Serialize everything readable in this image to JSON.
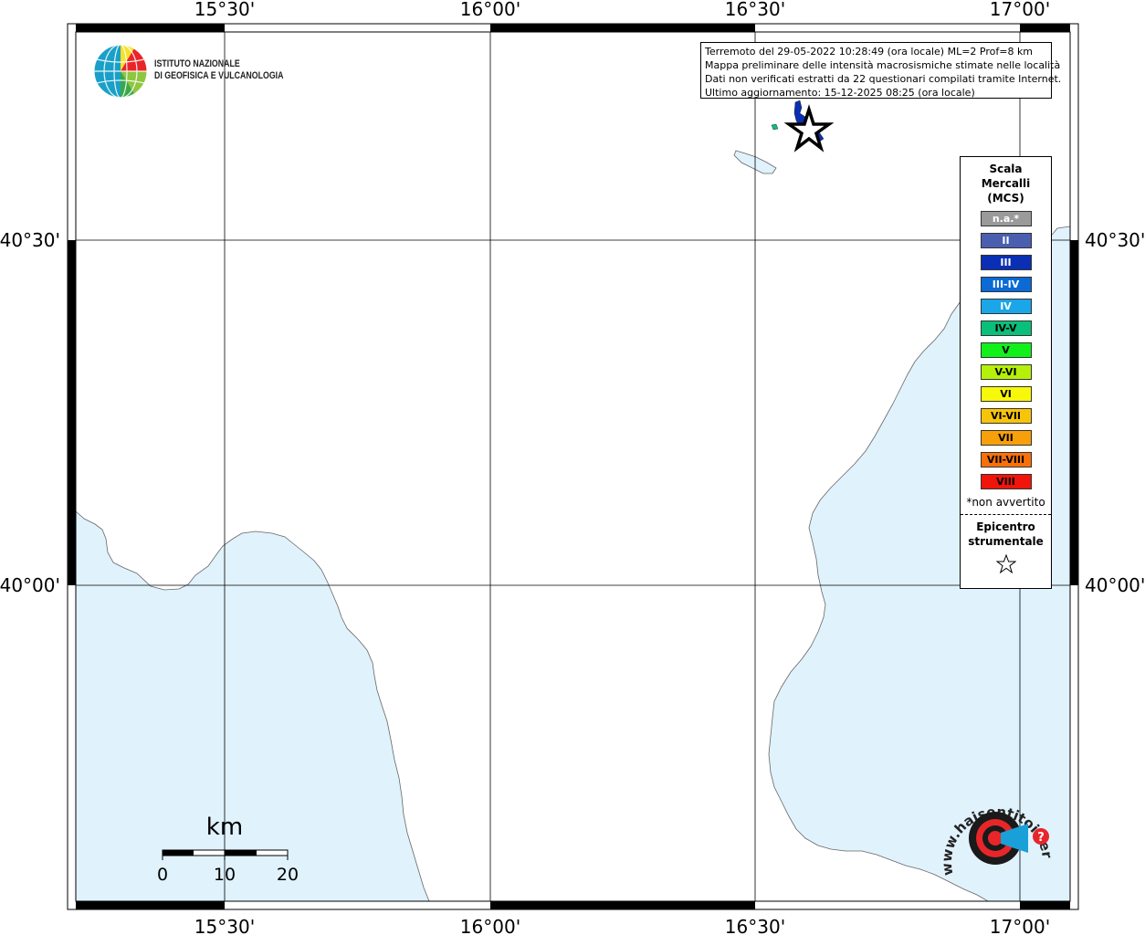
{
  "map": {
    "x_ticks": [
      "15°30'",
      "16°00'",
      "16°30'",
      "17°00'"
    ],
    "y_ticks": [
      "40°30'",
      "40°00'"
    ],
    "land_color": "#ffffff",
    "sea_color": "#e0f2fc",
    "grid_color": "#000000"
  },
  "info": {
    "line1": "Terremoto del 29-05-2022 10:28:49 (ora locale) ML=2 Prof=8 km",
    "line2": "Mappa preliminare delle intensità macrosismiche stimate nelle località",
    "line3": "Dati non verificati estratti da 22 questionari compilati tramite Internet.",
    "line4": "Ultimo aggiornamento: 15-12-2025 08:25 (ora locale)"
  },
  "legend": {
    "title_line1": "Scala",
    "title_line2": "Mercalli",
    "title_line3": "(MCS)",
    "items": [
      {
        "label": "n.a.*",
        "color": "#9a9a9a",
        "text_color": "#ffffff"
      },
      {
        "label": "II",
        "color": "#4a5fb0",
        "text_color": "#ffffff"
      },
      {
        "label": "III",
        "color": "#0a2fb4",
        "text_color": "#ffffff"
      },
      {
        "label": "III-IV",
        "color": "#0a6ad6",
        "text_color": "#ffffff"
      },
      {
        "label": "IV",
        "color": "#1aa6e8",
        "text_color": "#ffffff"
      },
      {
        "label": "IV-V",
        "color": "#0abf7a",
        "text_color": "#000000"
      },
      {
        "label": "V",
        "color": "#12f01a",
        "text_color": "#000000"
      },
      {
        "label": "V-VI",
        "color": "#b4f00a",
        "text_color": "#000000"
      },
      {
        "label": "VI",
        "color": "#f8f80a",
        "text_color": "#000000"
      },
      {
        "label": "VI-VII",
        "color": "#f8c40a",
        "text_color": "#000000"
      },
      {
        "label": "VII",
        "color": "#f8a00a",
        "text_color": "#000000"
      },
      {
        "label": "VII-VIII",
        "color": "#f8700a",
        "text_color": "#000000"
      },
      {
        "label": "VIII",
        "color": "#f0140a",
        "text_color": "#000000"
      }
    ],
    "note": "*non avvertito",
    "epicenter_line1": "Epicentro",
    "epicenter_line2": "strumentale"
  },
  "scale_bar": {
    "unit": "km",
    "ticks": [
      "0",
      "10",
      "20"
    ]
  },
  "ingv": {
    "line1": "ISTITUTO NAZIONALE",
    "line2": "DI GEOFISICA E VULCANOLOGIA"
  },
  "hsit": {
    "text": "www.haisentitoilterremoto.it"
  },
  "icons": [
    "ingv-globe-icon",
    "epicenter-star-icon",
    "hsit-target-icon",
    "megaphone-icon"
  ]
}
